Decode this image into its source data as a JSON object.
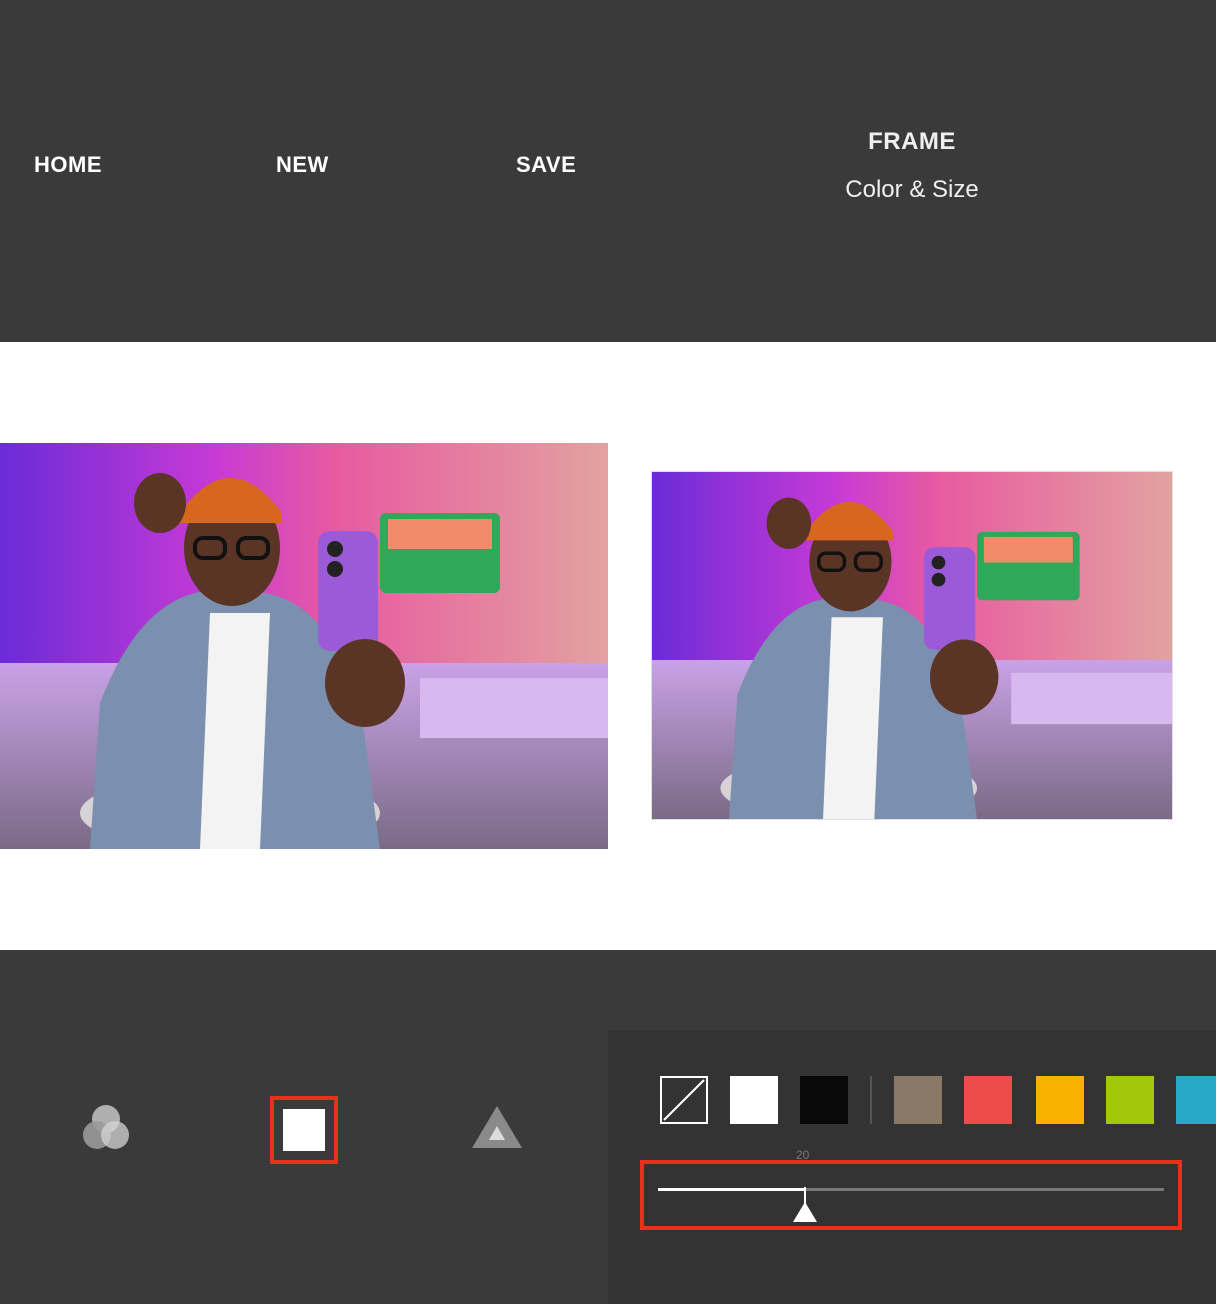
{
  "topbar": {
    "home_label": "HOME",
    "new_label": "NEW",
    "save_label": "SAVE",
    "mode_title": "FRAME",
    "mode_subtitle": "Color & Size"
  },
  "tools": [
    {
      "name": "blend",
      "icon": "circles-icon",
      "selected": false
    },
    {
      "name": "frame",
      "icon": "square-frame-icon",
      "selected": true
    },
    {
      "name": "shape",
      "icon": "triangle-icon",
      "selected": false
    }
  ],
  "swatches": [
    {
      "name": "none",
      "color": "transparent"
    },
    {
      "name": "white",
      "color": "#ffffff"
    },
    {
      "name": "black",
      "color": "#0a0a0a"
    },
    {
      "name": "taupe",
      "color": "#8a7866"
    },
    {
      "name": "red",
      "color": "#f04b4b"
    },
    {
      "name": "orange",
      "color": "#fbb100"
    },
    {
      "name": "green",
      "color": "#a3c70a"
    },
    {
      "name": "teal",
      "color": "#2aa8c8"
    }
  ],
  "frame_size": {
    "value_label": "20",
    "fraction": 0.29
  },
  "colors": {
    "accent_highlight": "#e8311a",
    "bar_bg": "#3a3a3a",
    "panel_bg": "#333333"
  }
}
